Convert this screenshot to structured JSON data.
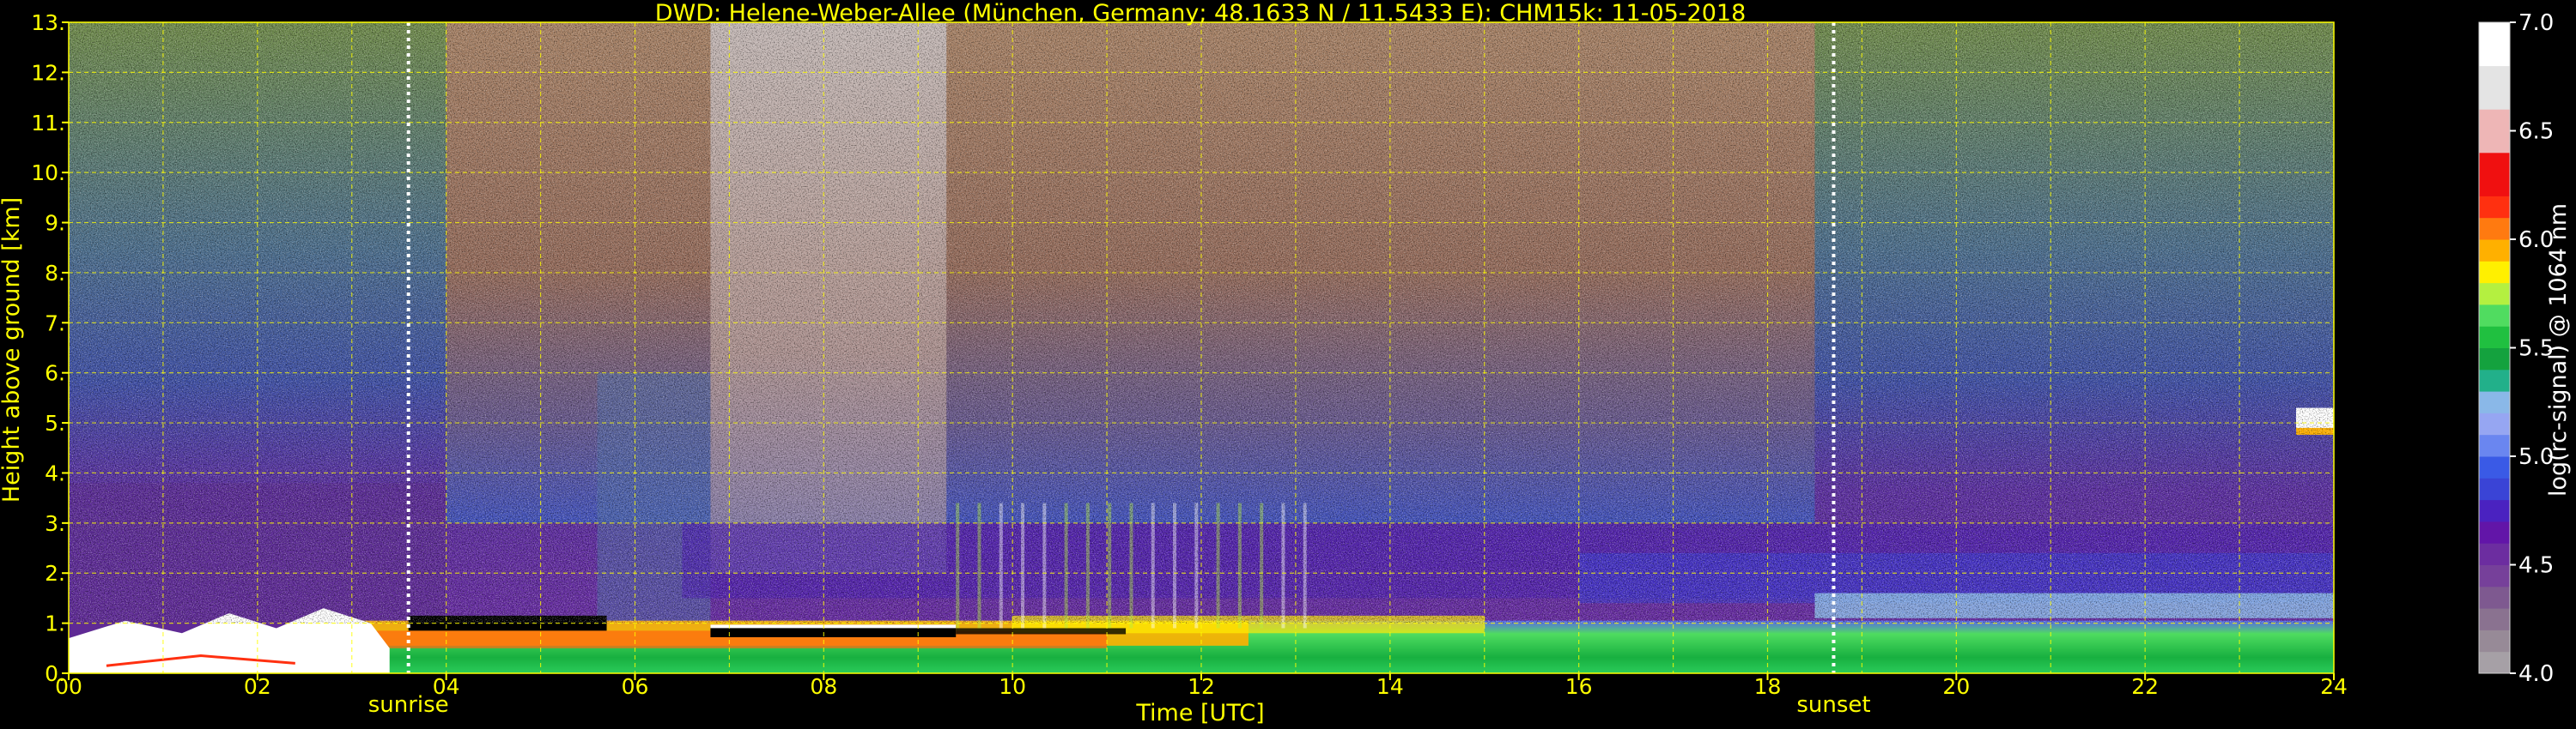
{
  "chart_data": {
    "type": "heatmap",
    "title": "DWD: Helene-Weber-Allee (München, Germany; 48.1633 N / 11.5433 E):    CHM15k: 11-05-2018",
    "xlabel": "Time [UTC]",
    "ylabel": "Height above ground [km]",
    "xlim": [
      0,
      24
    ],
    "ylim": [
      0,
      13
    ],
    "xticks": [
      "00",
      "02",
      "04",
      "06",
      "08",
      "10",
      "12",
      "14",
      "16",
      "18",
      "20",
      "22",
      "24"
    ],
    "yticks": [
      "0.",
      "1.",
      "2.",
      "3.",
      "4.",
      "5.",
      "6.",
      "7.",
      "8.",
      "9.",
      "10.",
      "11.",
      "12.",
      "13."
    ],
    "grid": true,
    "events": [
      {
        "label": "sunrise",
        "time": 3.6
      },
      {
        "label": "sunset",
        "time": 18.7
      }
    ],
    "colorbar": {
      "label": "log(rc-signal) @ 1064 nm",
      "range": [
        4.0,
        7.0
      ],
      "ticks": [
        "4.0",
        "4.5",
        "5.0",
        "5.5",
        "6.0",
        "6.5",
        "7.0"
      ],
      "levels": [
        {
          "value": 4.0,
          "color": "#a6a0a6"
        },
        {
          "value": 4.1,
          "color": "#978a97"
        },
        {
          "value": 4.2,
          "color": "#8a7290"
        },
        {
          "value": 4.3,
          "color": "#7e5990"
        },
        {
          "value": 4.4,
          "color": "#76409a"
        },
        {
          "value": 4.5,
          "color": "#6c2da0"
        },
        {
          "value": 4.6,
          "color": "#6215a8"
        },
        {
          "value": 4.7,
          "color": "#4a22c0"
        },
        {
          "value": 4.8,
          "color": "#3a44d6"
        },
        {
          "value": 4.9,
          "color": "#3a5ae6"
        },
        {
          "value": 5.0,
          "color": "#6a86f0"
        },
        {
          "value": 5.1,
          "color": "#96a6f2"
        },
        {
          "value": 5.2,
          "color": "#8ab8e8"
        },
        {
          "value": 5.3,
          "color": "#22b08a"
        },
        {
          "value": 5.4,
          "color": "#14a23e"
        },
        {
          "value": 5.5,
          "color": "#20c040"
        },
        {
          "value": 5.6,
          "color": "#50dc60"
        },
        {
          "value": 5.7,
          "color": "#b4f040"
        },
        {
          "value": 5.8,
          "color": "#fff000"
        },
        {
          "value": 5.9,
          "color": "#ffb000"
        },
        {
          "value": 6.0,
          "color": "#ff7a10"
        },
        {
          "value": 6.1,
          "color": "#ff3010"
        },
        {
          "value": 6.2,
          "color": "#f01010"
        },
        {
          "value": 6.4,
          "color": "#eeb6b6"
        },
        {
          "value": 6.6,
          "color": "#e4e4e4"
        },
        {
          "value": 6.8,
          "color": "#ffffff"
        }
      ]
    },
    "layers": [
      {
        "name": "boundary-layer-aerosol",
        "time": [
          2.5,
          24
        ],
        "height_km": [
          0,
          1.5
        ]
      },
      {
        "name": "residual-layer",
        "time": [
          6.5,
          24
        ],
        "height_km": [
          1.5,
          3.0
        ]
      },
      {
        "name": "cloud-top-right",
        "time": [
          23.6,
          24
        ],
        "height_km": [
          4.8,
          5.3
        ]
      }
    ]
  },
  "colors": {
    "background": "#000000",
    "axes": "#ffff00",
    "grid": "#ffff00",
    "colorbar_text": "#ffffff"
  }
}
